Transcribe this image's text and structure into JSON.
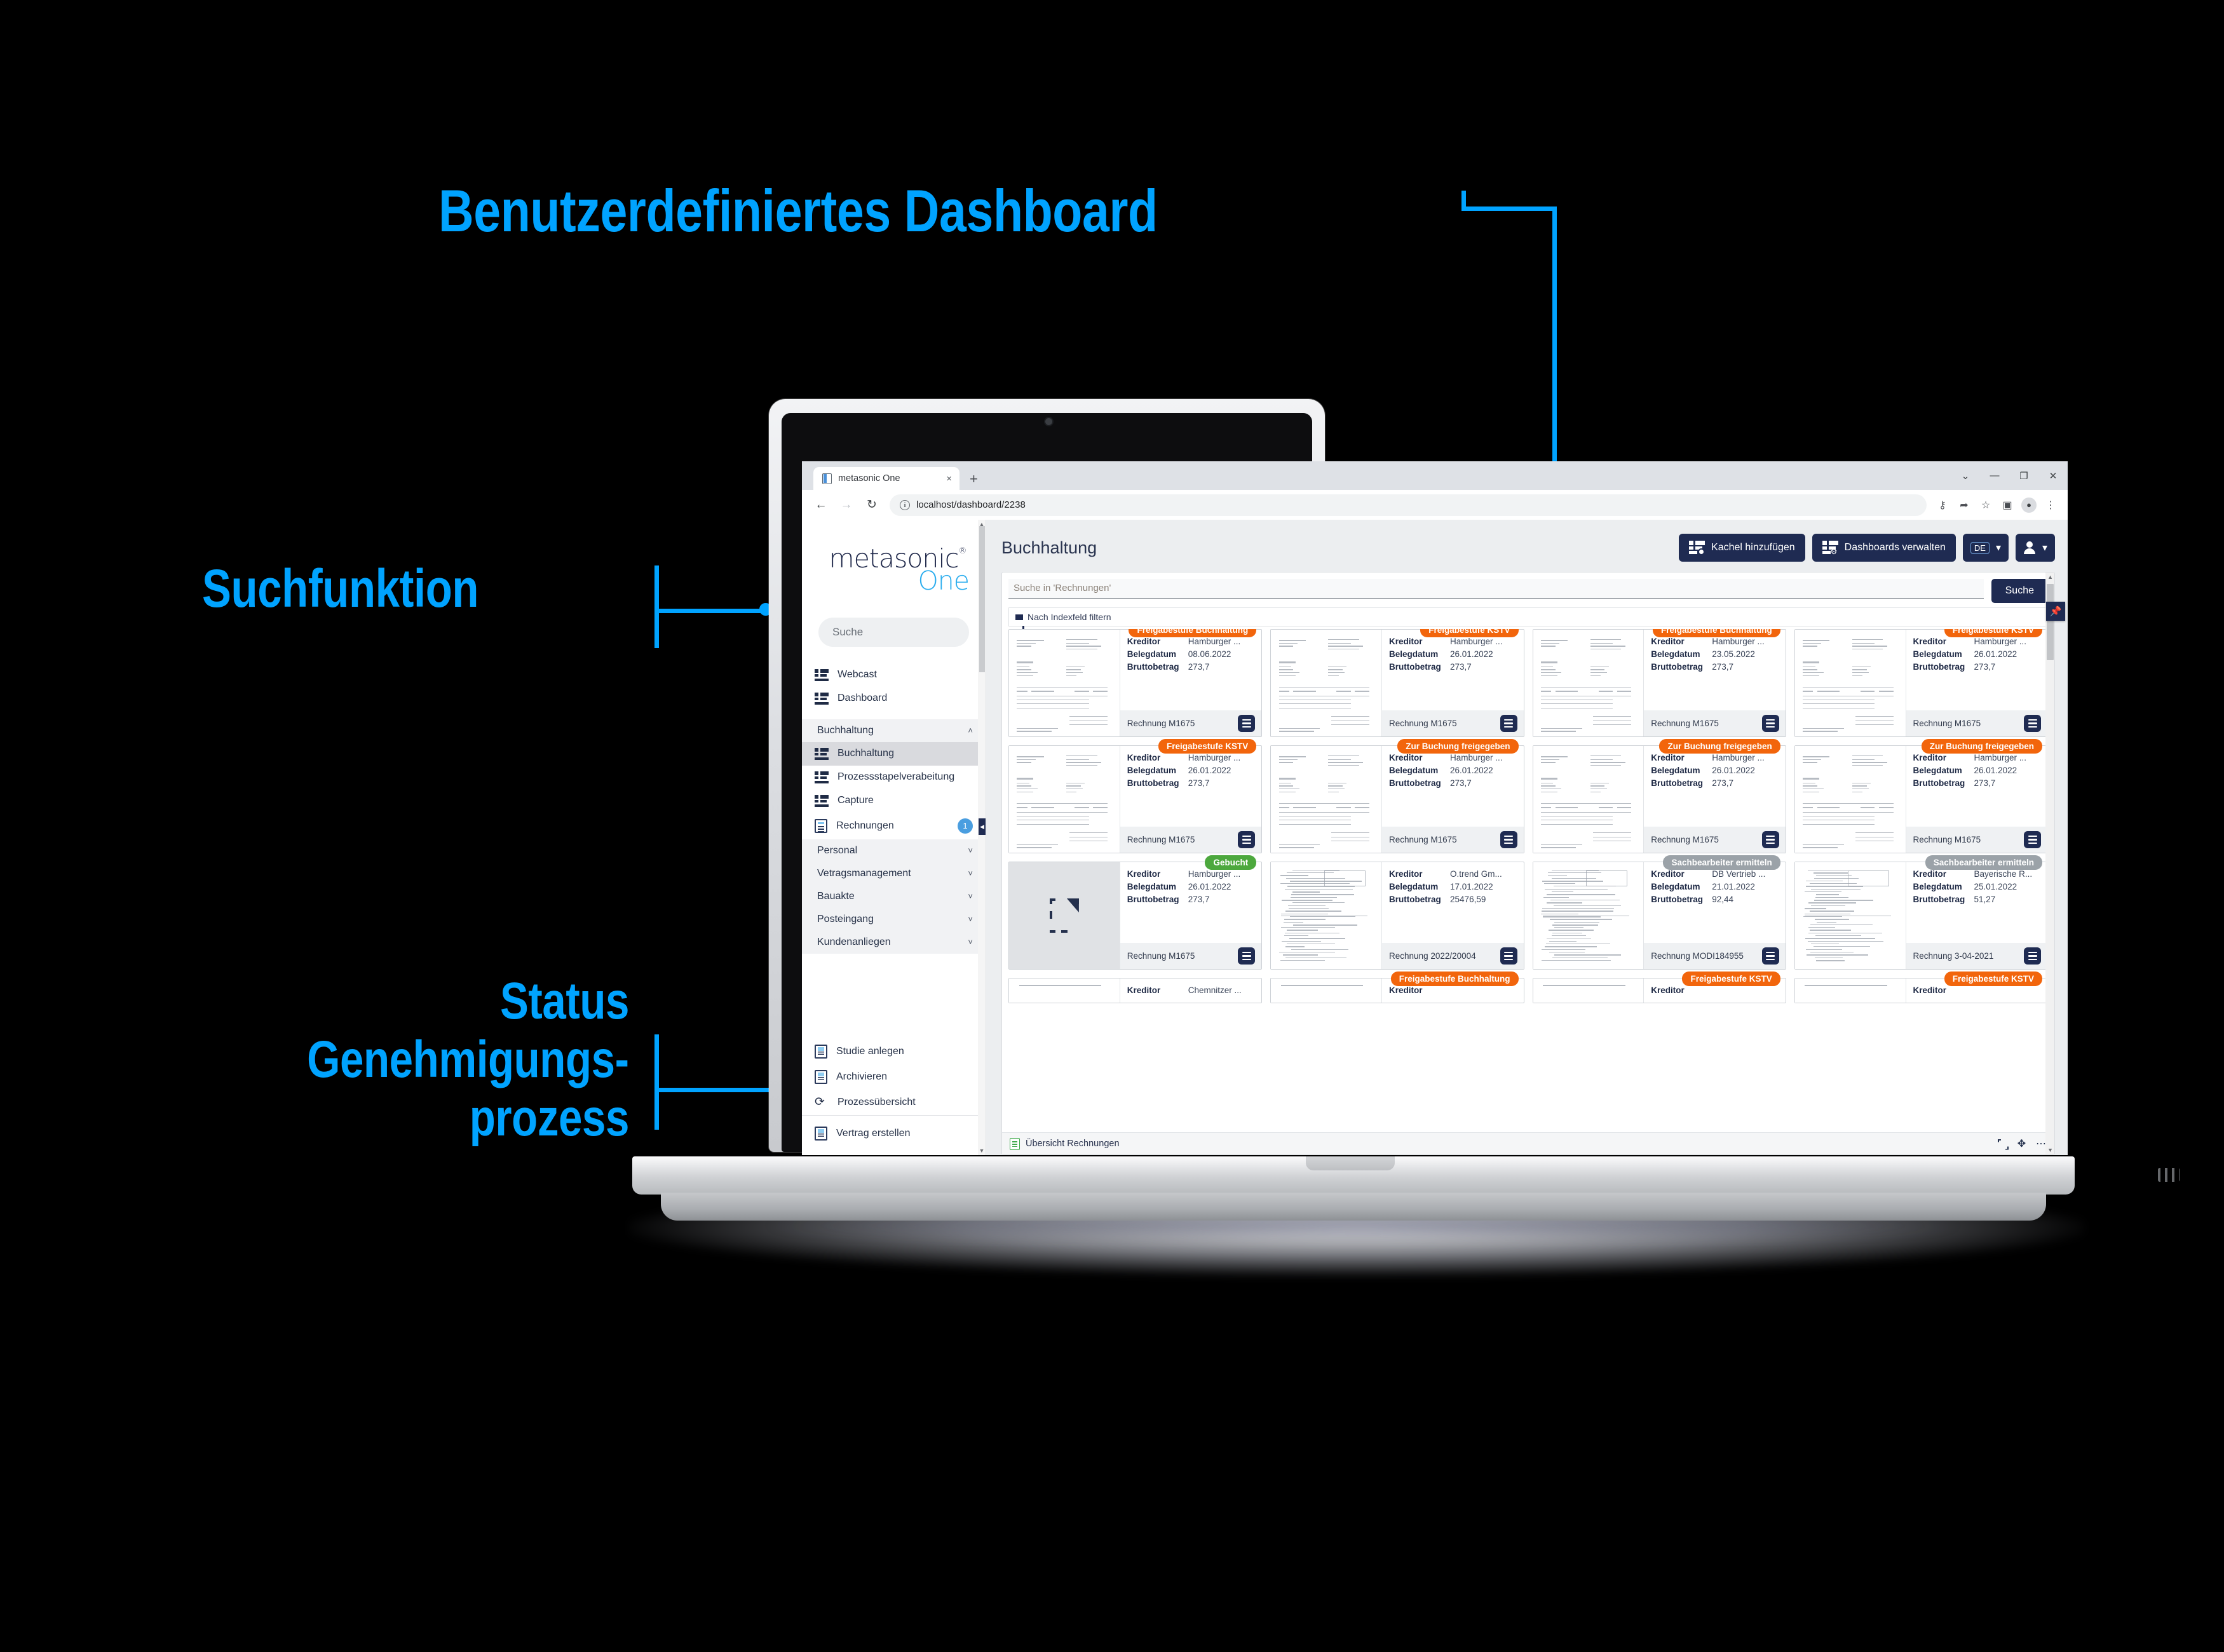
{
  "annotations": {
    "dashboard": "Benutzerdefiniertes Dashboard",
    "search": "Suchfunktion",
    "status": "Status Genehmigungs­prozess",
    "accent_color": "#00A3FF"
  },
  "browser": {
    "tab_title": "metasonic One",
    "tab_close": "×",
    "new_tab": "+",
    "back": "←",
    "forward": "→",
    "reload": "↻",
    "site_info": "i",
    "url": "localhost/dashboard/2238",
    "ext_key": "⚷",
    "ext_share": "➦",
    "ext_star": "☆",
    "ext_panel": "▣",
    "ext_menu": "⋮",
    "profile": "●",
    "win_chevron": "⌄",
    "win_min": "—",
    "win_max": "❐",
    "win_close": "✕"
  },
  "sidebar": {
    "logo_main": "metasonic",
    "logo_reg": "®",
    "logo_sub": "One",
    "search_placeholder": "Suche",
    "items": [
      {
        "label": "Webcast",
        "icon": "list-icon",
        "type": "link"
      },
      {
        "label": "Dashboard",
        "icon": "list-icon",
        "type": "link"
      },
      {
        "label": "Buchhaltung",
        "icon": "none",
        "type": "group",
        "caret": "˄",
        "expanded": true
      },
      {
        "label": "Buchhaltung",
        "icon": "list-icon",
        "type": "sub",
        "active": true
      },
      {
        "label": "Prozessstapelverabeitung",
        "icon": "list-icon",
        "type": "sub"
      },
      {
        "label": "Capture",
        "icon": "list-icon",
        "type": "sub"
      },
      {
        "label": "Rechnungen",
        "icon": "doc-icon",
        "type": "sub",
        "badge": "1"
      },
      {
        "label": "Personal",
        "icon": "none",
        "type": "group",
        "caret": "˅"
      },
      {
        "label": "Vetragsmanagement",
        "icon": "none",
        "type": "group",
        "caret": "˅"
      },
      {
        "label": "Bauakte",
        "icon": "none",
        "type": "group",
        "caret": "˅"
      },
      {
        "label": "Posteingang",
        "icon": "none",
        "type": "group",
        "caret": "˅"
      },
      {
        "label": "Kundenanliegen",
        "icon": "none",
        "type": "group",
        "caret": "˅"
      }
    ],
    "actions": [
      {
        "label": "Studie anlegen",
        "icon": "save-icon"
      },
      {
        "label": "Archivieren",
        "icon": "save-icon"
      },
      {
        "label": "Prozessübersicht",
        "icon": "process-icon"
      }
    ],
    "footer_actions": [
      {
        "label": "Vertrag erstellen",
        "icon": "save-icon"
      }
    ]
  },
  "main": {
    "title": "Buchhaltung",
    "toolbar": {
      "add_tile": "Kachel hinzufügen",
      "manage_dashboards": "Dashboards verwalten",
      "language": "DE",
      "caret": "▾"
    },
    "search": {
      "placeholder": "Suche in 'Rechnungen'",
      "button": "Suche"
    },
    "filter_label": "Nach Indexfeld filtern",
    "field_labels": {
      "kreditor": "Kreditor",
      "belegdatum": "Belegdatum",
      "bruttobetrag": "Bruttobetrag"
    },
    "footer": {
      "label": "Übersicht Rechnungen",
      "icons": [
        "expand-icon",
        "move-icon",
        "more-icon"
      ]
    },
    "pin_icon": "📌",
    "cards": [
      {
        "badge": "Freigabestufe Buchhaltung",
        "badge_type": "orange",
        "kreditor": "Hamburger ...",
        "belegdatum": "08.06.2022",
        "bruttobetrag": "273,7",
        "name": "Rechnung M1675",
        "thumb": "invoice"
      },
      {
        "badge": "Freigabestufe KSTV",
        "badge_type": "orange",
        "kreditor": "Hamburger ...",
        "belegdatum": "26.01.2022",
        "bruttobetrag": "273,7",
        "name": "Rechnung M1675",
        "thumb": "invoice"
      },
      {
        "badge": "Freigabestufe Buchhaltung",
        "badge_type": "orange",
        "kreditor": "Hamburger ...",
        "belegdatum": "23.05.2022",
        "bruttobetrag": "273,7",
        "name": "Rechnung M1675",
        "thumb": "invoice"
      },
      {
        "badge": "Freigabestufe KSTV",
        "badge_type": "orange",
        "kreditor": "Hamburger ...",
        "belegdatum": "26.01.2022",
        "bruttobetrag": "273,7",
        "name": "Rechnung M1675",
        "thumb": "invoice"
      },
      {
        "badge": "Freigabestufe KSTV",
        "badge_type": "orange",
        "kreditor": "Hamburger ...",
        "belegdatum": "26.01.2022",
        "bruttobetrag": "273,7",
        "name": "Rechnung M1675",
        "thumb": "invoice"
      },
      {
        "badge": "Zur Buchung freigegeben",
        "badge_type": "orange",
        "kreditor": "Hamburger ...",
        "belegdatum": "26.01.2022",
        "bruttobetrag": "273,7",
        "name": "Rechnung M1675",
        "thumb": "invoice"
      },
      {
        "badge": "Zur Buchung freigegeben",
        "badge_type": "orange",
        "kreditor": "Hamburger ...",
        "belegdatum": "26.01.2022",
        "bruttobetrag": "273,7",
        "name": "Rechnung M1675",
        "thumb": "invoice"
      },
      {
        "badge": "Zur Buchung freigegeben",
        "badge_type": "orange",
        "kreditor": "Hamburger ...",
        "belegdatum": "26.01.2022",
        "bruttobetrag": "273,7",
        "name": "Rechnung M1675",
        "thumb": "invoice"
      },
      {
        "badge": "Gebucht",
        "badge_type": "green",
        "kreditor": "Hamburger ...",
        "belegdatum": "26.01.2022",
        "bruttobetrag": "273,7",
        "name": "Rechnung M1675",
        "thumb": "empty"
      },
      {
        "badge": "",
        "badge_type": "none",
        "kreditor": "O.trend Gm...",
        "belegdatum": "17.01.2022",
        "bruttobetrag": "25476,59",
        "name": "Rechnung 2022/20004",
        "thumb": "scan"
      },
      {
        "badge": "Sachbearbeiter ermitteln",
        "badge_type": "gray",
        "kreditor": "DB Vertrieb ...",
        "belegdatum": "21.01.2022",
        "bruttobetrag": "92,44",
        "name": "Rechnung MODI184955",
        "thumb": "scan"
      },
      {
        "badge": "Sachbearbeiter ermitteln",
        "badge_type": "gray",
        "kreditor": "Bayerische R...",
        "belegdatum": "25.01.2022",
        "bruttobetrag": "51,27",
        "name": "Rechnung 3-04-2021",
        "thumb": "scan"
      }
    ],
    "cards_row4": [
      {
        "badge": "",
        "badge_type": "none",
        "kreditor": "Chemnitzer ..."
      },
      {
        "badge": "Freigabestufe Buchhaltung",
        "badge_type": "orange",
        "kreditor": ""
      },
      {
        "badge": "Freigabestufe KSTV",
        "badge_type": "orange",
        "kreditor": ""
      },
      {
        "badge": "Freigabestufe KSTV",
        "badge_type": "orange",
        "kreditor": ""
      }
    ]
  }
}
